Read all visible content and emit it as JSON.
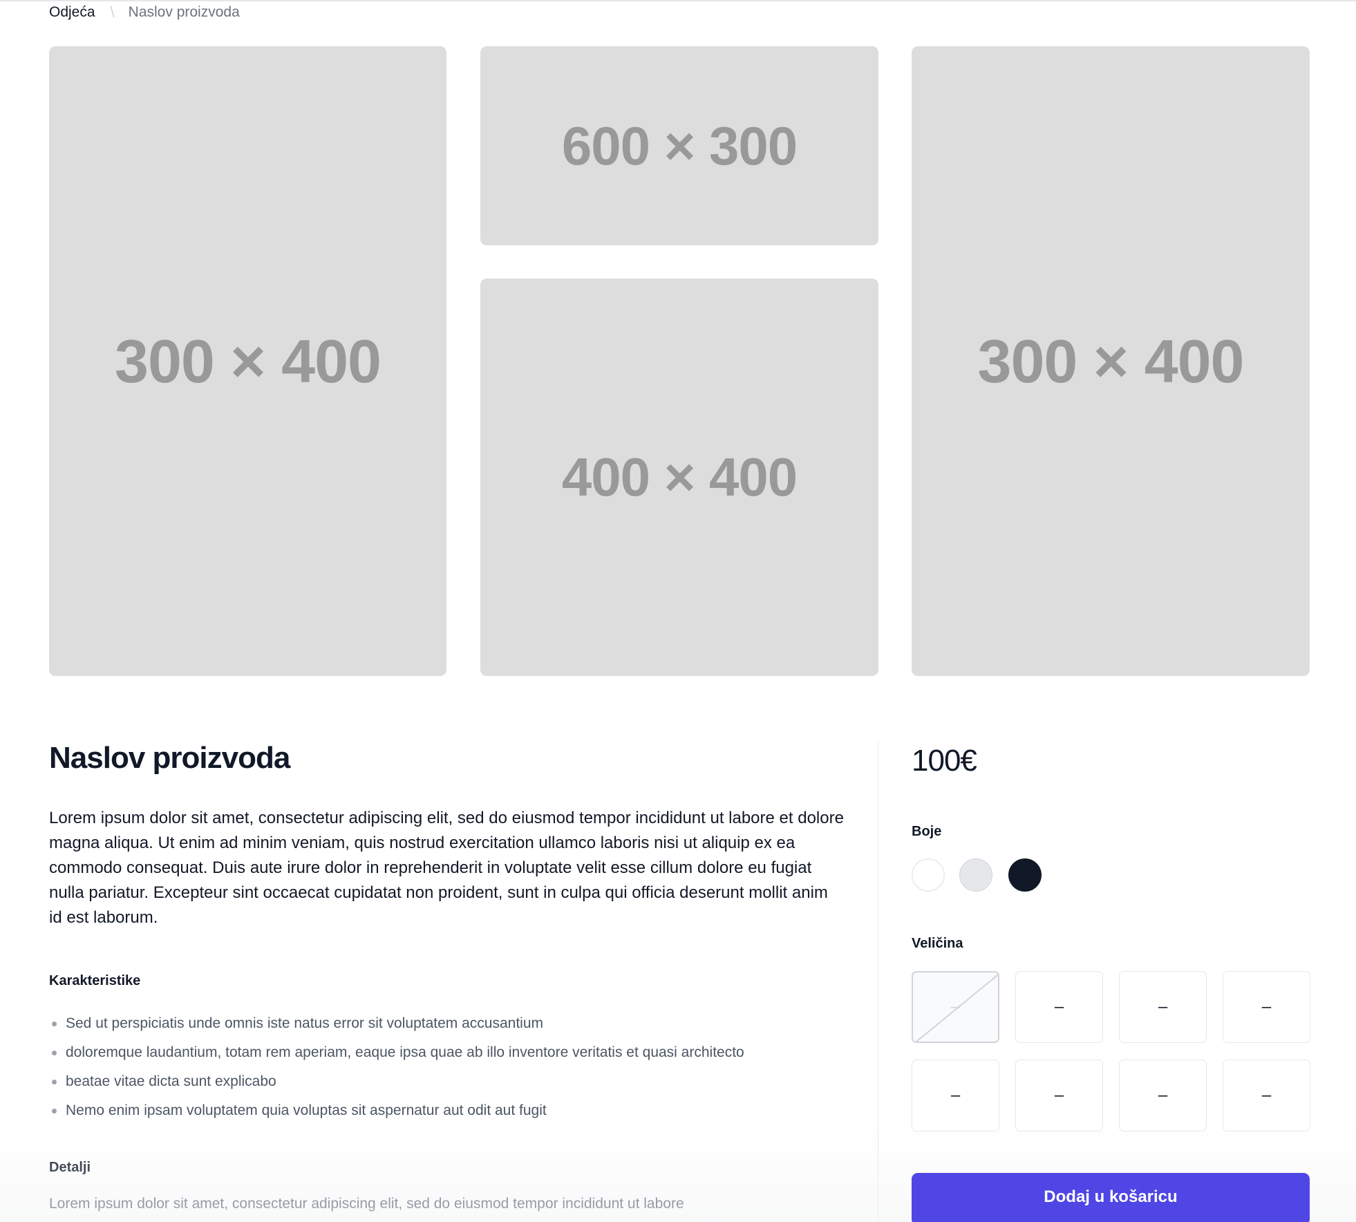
{
  "breadcrumb": {
    "category": "Odjeća",
    "separator": "\\",
    "current": "Naslov proizvoda"
  },
  "gallery": [
    {
      "label": "300 × 400"
    },
    {
      "label": "600 × 300"
    },
    {
      "label": "400 × 400"
    },
    {
      "label": "300 × 400"
    }
  ],
  "product": {
    "title": "Naslov proizvoda",
    "description": "Lorem ipsum dolor sit amet, consectetur adipiscing elit, sed do eiusmod tempor incididunt ut labore et dolore magna aliqua. Ut enim ad minim veniam, quis nostrud exercitation ullamco laboris nisi ut aliquip ex ea commodo consequat. Duis aute irure dolor in reprehenderit in voluptate velit esse cillum dolore eu fugiat nulla pariatur. Excepteur sint occaecat cupidatat non proident, sunt in culpa qui officia deserunt mollit anim id est laborum.",
    "features_heading": "Karakteristike",
    "features": [
      "Sed ut perspiciatis unde omnis iste natus error sit voluptatem accusantium",
      "doloremque laudantium, totam rem aperiam, eaque ipsa quae ab illo inventore veritatis et quasi architecto",
      "beatae vitae dicta sunt explicabo",
      "Nemo enim ipsam voluptatem quia voluptas sit aspernatur aut odit aut fugit"
    ],
    "details_heading": "Detalji",
    "details_text": "Lorem ipsum dolor sit amet, consectetur adipiscing elit, sed do eiusmod tempor incididunt ut labore"
  },
  "purchase": {
    "price": "100€",
    "colors_label": "Boje",
    "colors": [
      {
        "name": "white",
        "hex": "#ffffff"
      },
      {
        "name": "gray",
        "hex": "#e5e7eb"
      },
      {
        "name": "black",
        "hex": "#111827"
      }
    ],
    "size_label": "Veličina",
    "sizes": [
      "–",
      "–",
      "–",
      "–",
      "–",
      "–",
      "–",
      "–"
    ],
    "add_to_cart": "Dodaj u košaricu"
  },
  "colors": {
    "accent": "#4f46e5",
    "placeholder_bg": "#dddddd",
    "placeholder_text": "#999999"
  }
}
